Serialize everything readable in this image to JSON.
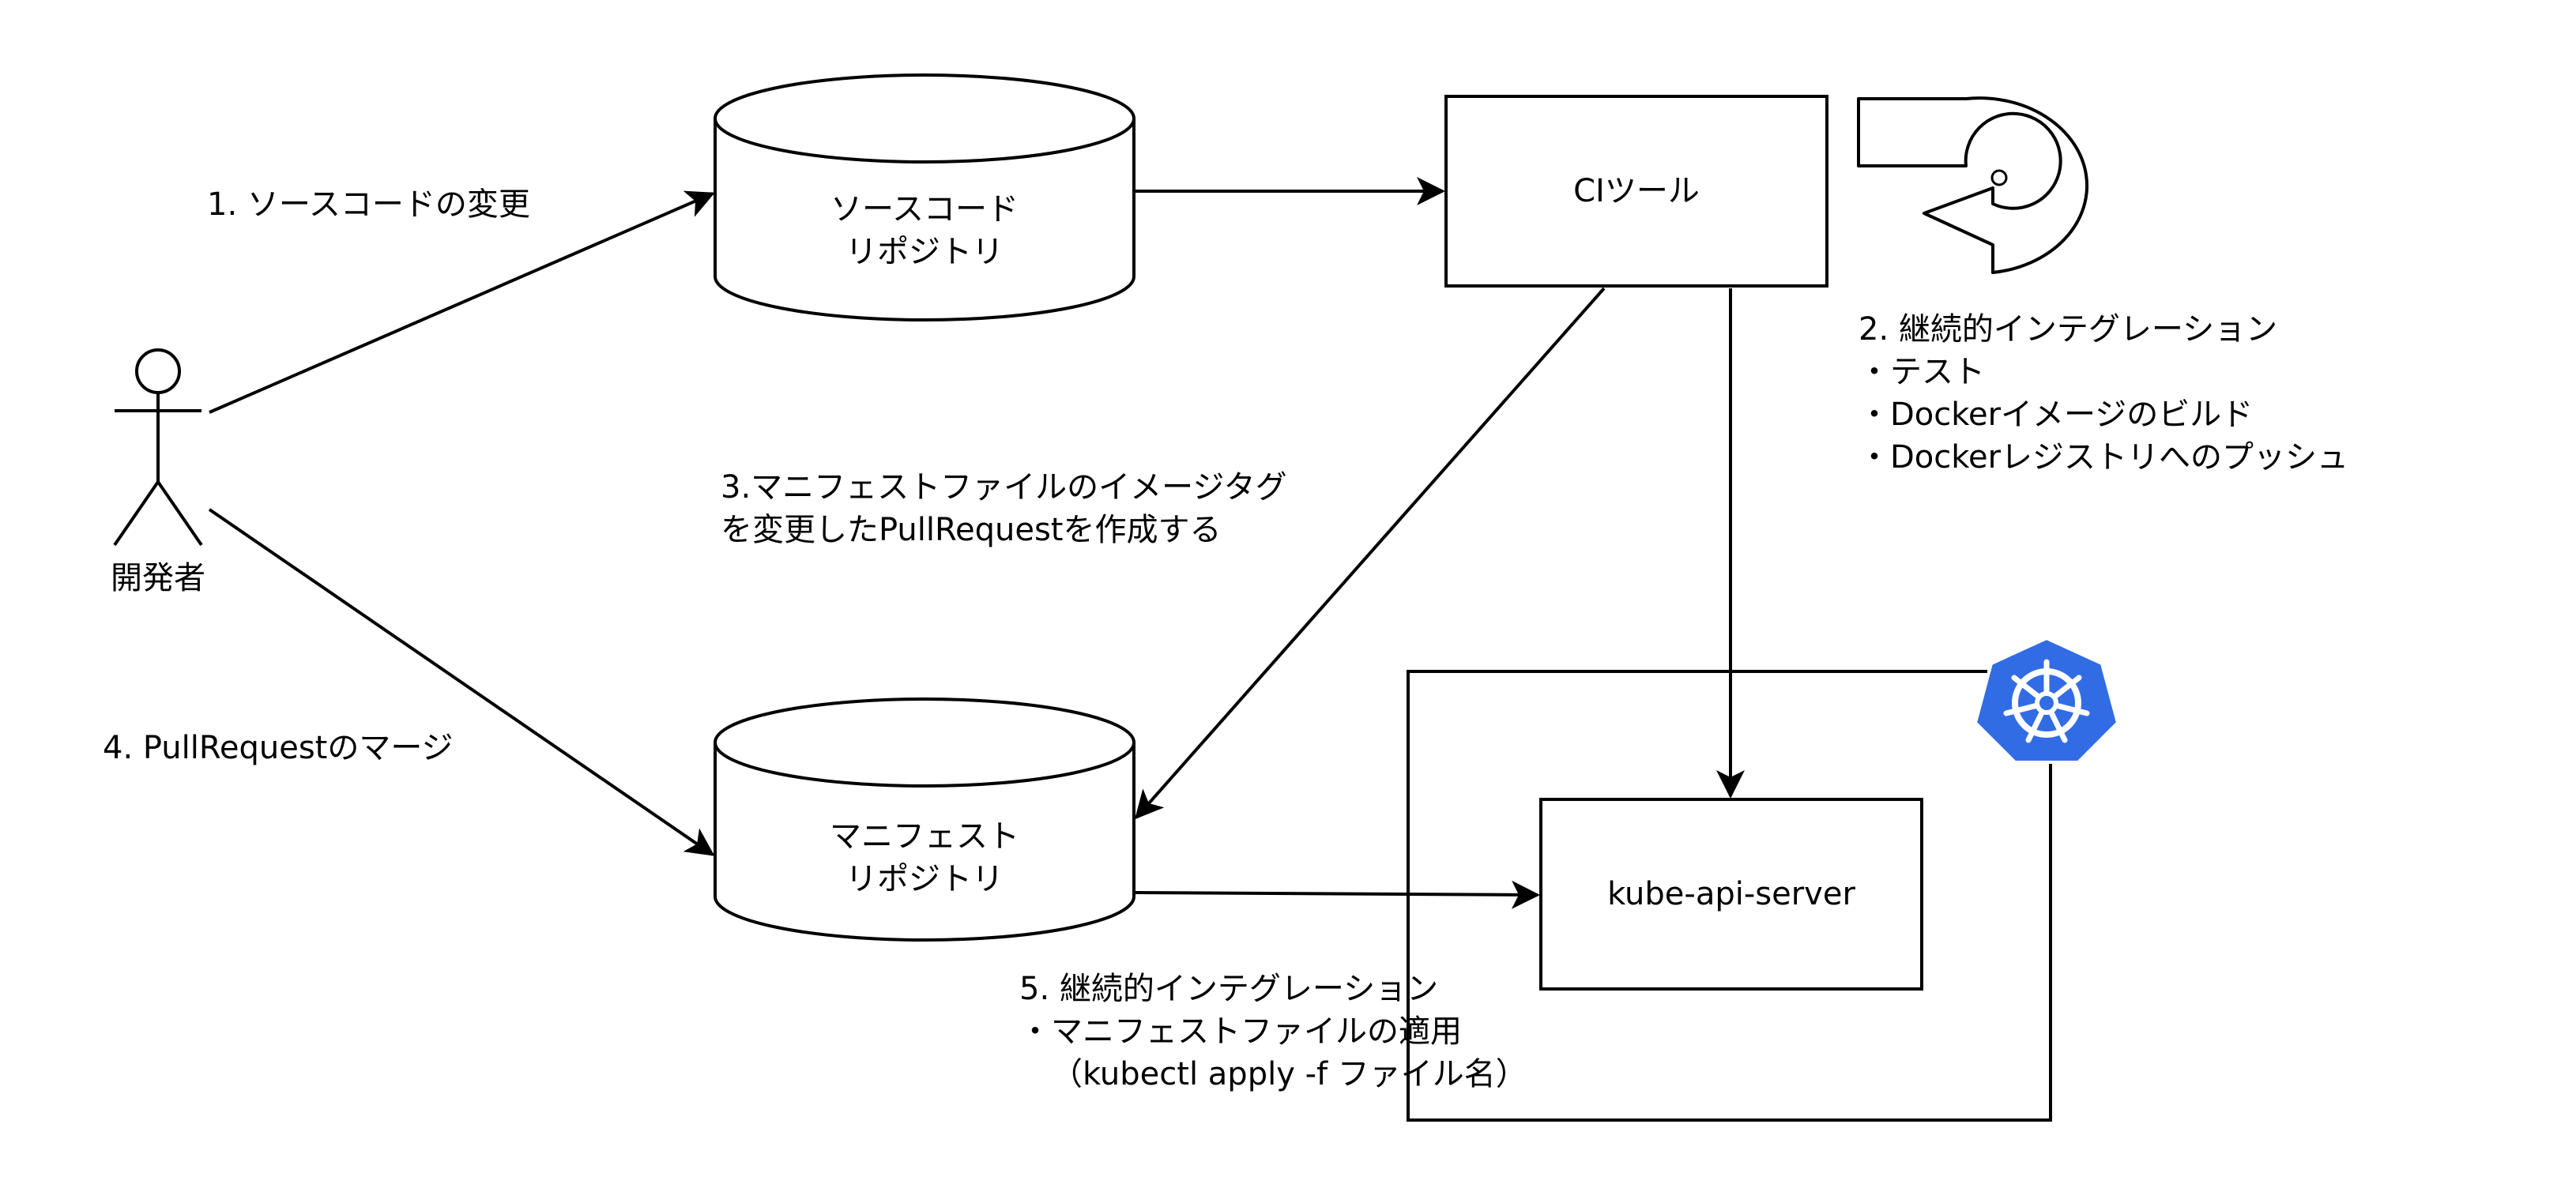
{
  "actor": {
    "label": "開発者"
  },
  "nodes": {
    "source_repo": [
      "ソースコード",
      "リポジトリ"
    ],
    "ci_tool": "CIツール",
    "manifest_repo": [
      "マニフェスト",
      "リポジトリ"
    ],
    "api_server": "kube-api-server"
  },
  "steps": {
    "step1": "1. ソースコードの変更",
    "step2": [
      "2. 継続的インテグレーション",
      "・テスト",
      "・Dockerイメージのビルド",
      "・Dockerレジストリへのプッシュ"
    ],
    "step3": [
      "3.マニフェストファイルのイメージタグ",
      "を変更したPullRequestを作成する"
    ],
    "step4": "4. PullRequestのマージ",
    "step5": [
      "5. 継続的インテグレーション",
      "・マニフェストファイルの適用",
      "（kubectl apply -f ファイル名）"
    ]
  },
  "icons": {
    "kubernetes": "kubernetes-logo-icon",
    "loop": "loop-arrow-icon",
    "actor": "stick-figure-icon"
  },
  "colors": {
    "stroke": "#000000",
    "kubernetes_blue": "#326CE5"
  }
}
